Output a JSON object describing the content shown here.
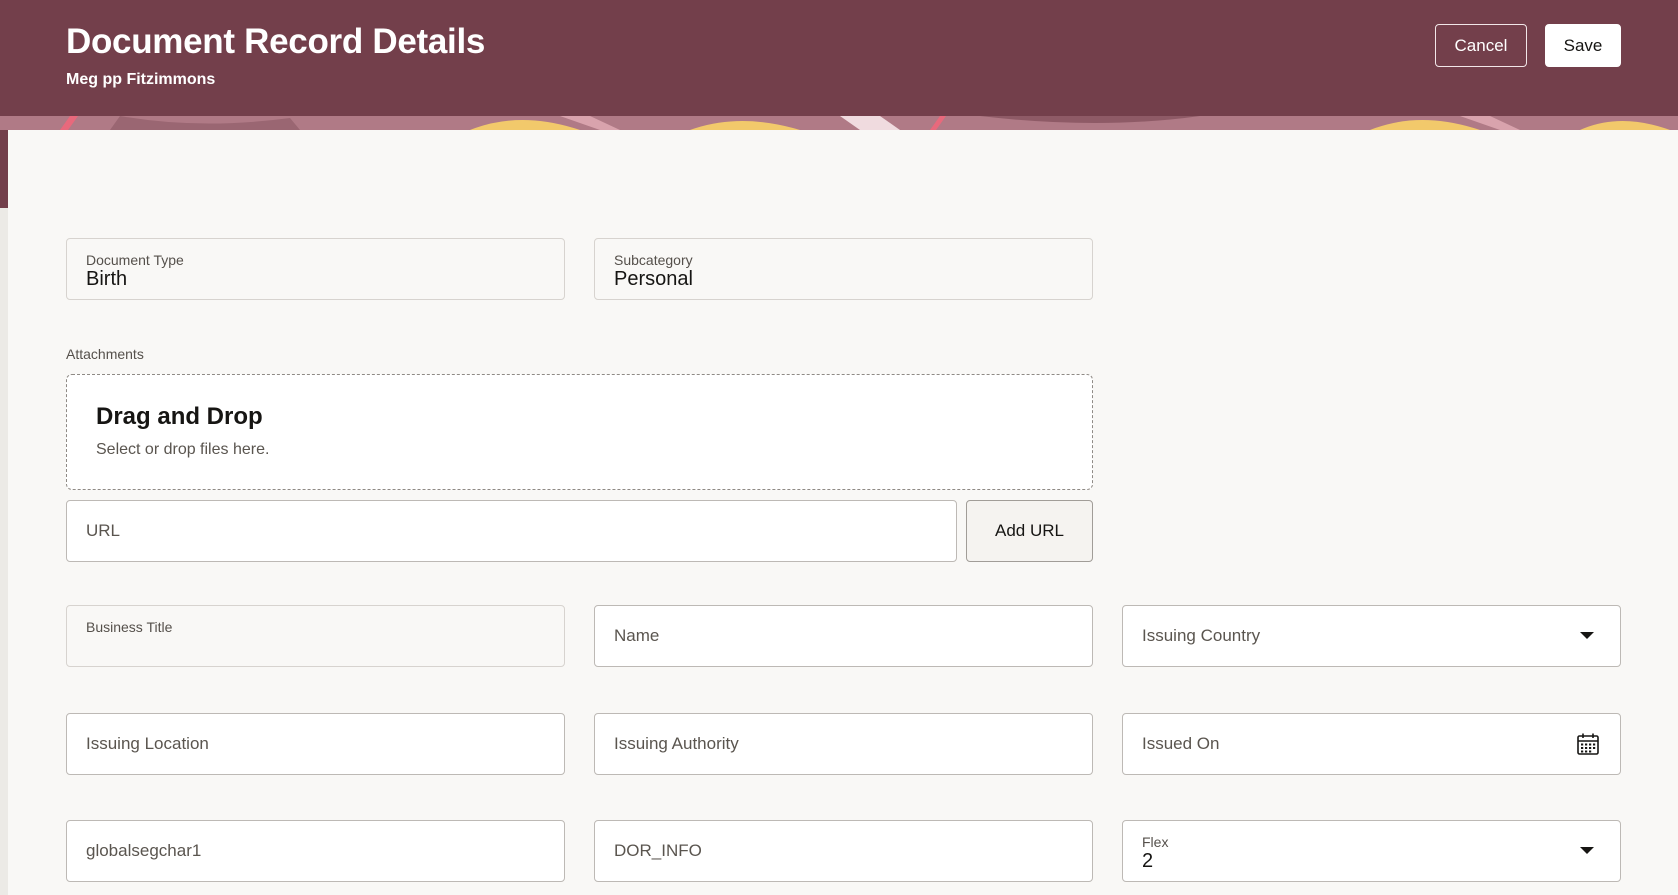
{
  "header": {
    "title": "Document Record Details",
    "subtitle": "Meg pp Fitzimmons",
    "cancel_label": "Cancel",
    "save_label": "Save",
    "background_color": "#733f4b"
  },
  "document_type": {
    "label": "Document Type",
    "value": "Birth"
  },
  "subcategory": {
    "label": "Subcategory",
    "value": "Personal"
  },
  "attachments": {
    "label": "Attachments",
    "dropzone_title": "Drag and Drop",
    "dropzone_subtitle": "Select or drop files here.",
    "url_placeholder": "URL",
    "add_url_label": "Add URL"
  },
  "fields": {
    "business_title": {
      "label": "Business Title",
      "value": ""
    },
    "name": {
      "placeholder": "Name"
    },
    "issuing_country": {
      "placeholder": "Issuing Country",
      "icon": "chevron-down-icon"
    },
    "issuing_location": {
      "placeholder": "Issuing Location"
    },
    "issuing_authority": {
      "placeholder": "Issuing Authority"
    },
    "issued_on": {
      "placeholder": "Issued On",
      "icon": "calendar-icon"
    },
    "globalsegchar1": {
      "placeholder": "globalsegchar1"
    },
    "dor_info": {
      "placeholder": "DOR_INFO"
    },
    "flex": {
      "label": "Flex",
      "value": "2",
      "icon": "chevron-down-icon"
    }
  }
}
